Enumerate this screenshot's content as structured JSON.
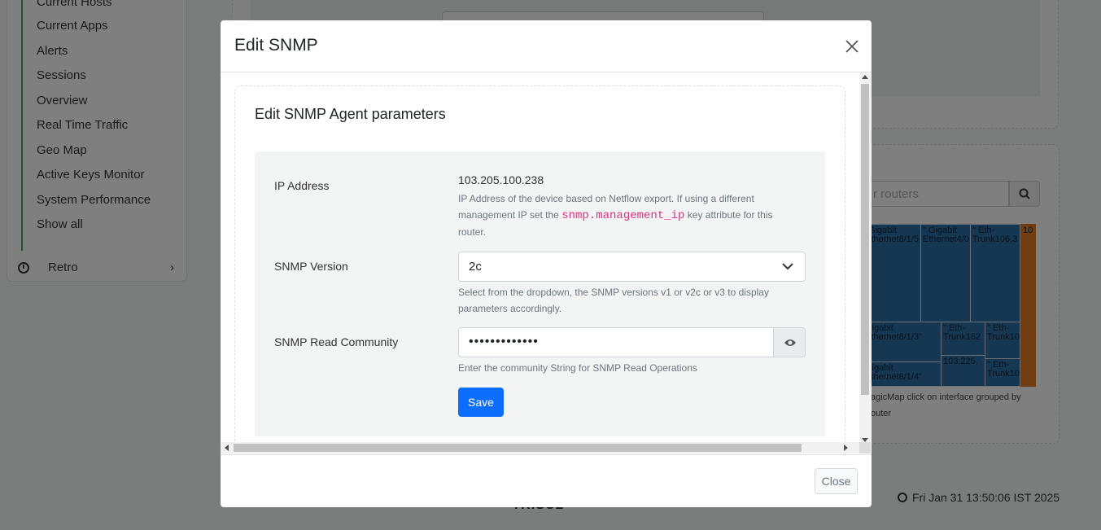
{
  "sidebar": {
    "items": [
      {
        "label": "Current Hosts"
      },
      {
        "label": "Current Apps"
      },
      {
        "label": "Alerts"
      },
      {
        "label": "Sessions"
      },
      {
        "label": "Overview"
      },
      {
        "label": "Real Time Traffic"
      },
      {
        "label": "Geo Map"
      },
      {
        "label": "Active Keys Monitor"
      },
      {
        "label": "System Performance"
      },
      {
        "label": "Show all"
      }
    ],
    "retro_label": "Retro"
  },
  "background": {
    "search_placeholder": "r routers",
    "treemap": {
      "cells": [
        "\"Gigabit Ethernet8/1/5",
        "\" Gigabit Ethernet4/0",
        "\" Eth-Trunk106.3",
        "10",
        "Gigabit Ethernet8/1/3\"",
        "\" Eth-Trunk162",
        "103.225.",
        "\" Eth-Trunk10",
        "\" Eth-Trunk10",
        "Gigabit Ethernet8/1/4\""
      ],
      "caption": "agicMap click on interface grouped by outer",
      "colors": {
        "primary": "#2b6fa3",
        "accent": "#e07a26"
      }
    },
    "footer_logo": "TRISUL",
    "footer_time": "Fri Jan 31 13:50:06 IST 2025"
  },
  "modal": {
    "title": "Edit SNMP",
    "card_title": "Edit SNMP Agent parameters",
    "ip": {
      "label": "IP Address",
      "value": "103.205.100.238",
      "help_before": "IP Address of the device based on Netflow export. If using a different management IP set the ",
      "help_code": "snmp.management_ip",
      "help_after": " key attribute for this router."
    },
    "version": {
      "label": "SNMP Version",
      "value": "2c",
      "help": "Select from the dropdown, the SNMP versions v1 or v2c or v3 to display parameters accordingly."
    },
    "community": {
      "label": "SNMP Read Community",
      "value": "•••••••••••••",
      "help": "Enter the community String for SNMP Read Operations"
    },
    "save_label": "Save",
    "close_label": "Close",
    "colors": {
      "primary_button": "#0d6efd",
      "code": "#d63384"
    }
  }
}
